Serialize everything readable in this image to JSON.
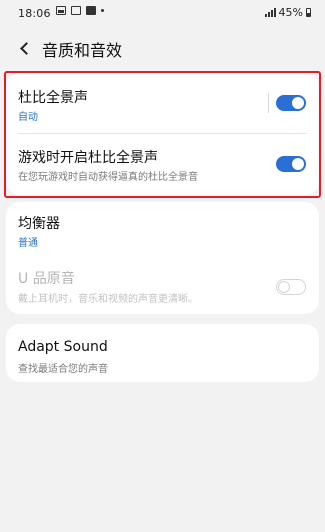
{
  "status_bar": {
    "time": "18:06",
    "battery": "45%"
  },
  "header": {
    "title": "音质和音效"
  },
  "dolby": {
    "title": "杜比全景声",
    "subtitle": "自动",
    "toggle_on": true
  },
  "dolby_gaming": {
    "title": "游戏时开启杜比全景声",
    "subtitle": "在您玩游戏时自动获得逼真的杜比全景音",
    "toggle_on": true
  },
  "equalizer": {
    "title": "均衡器",
    "subtitle": "普通"
  },
  "uhq": {
    "title": "U 品原音",
    "subtitle": "戴上耳机时，音乐和视频的声音更清晰。",
    "toggle_on": false,
    "enabled": false
  },
  "adapt_sound": {
    "title": "Adapt Sound",
    "subtitle": "查找最适合您的声音"
  },
  "colors": {
    "accent": "#2a6fd6",
    "highlight": "#e01e2c",
    "subtitle_blue": "#2a73c9"
  }
}
